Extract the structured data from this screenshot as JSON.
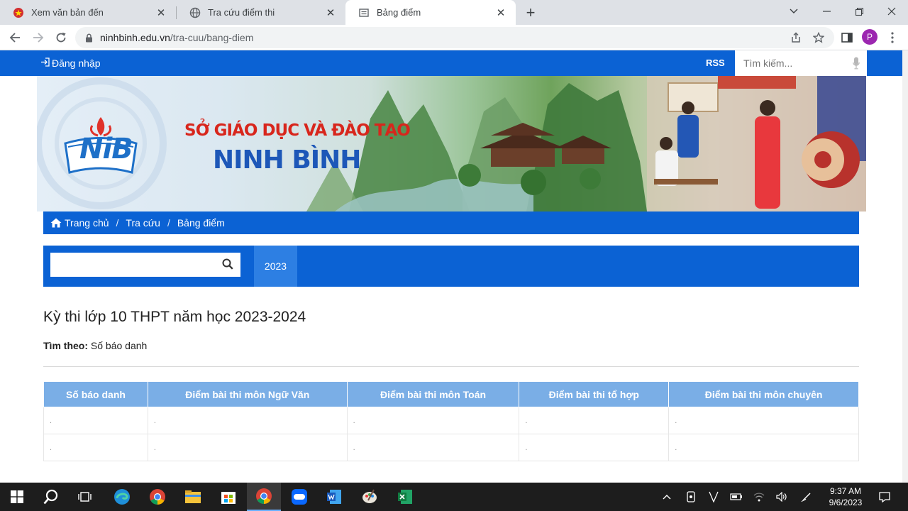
{
  "browser": {
    "tabs": [
      {
        "title": "Xem văn bản đến",
        "icon": "government-emblem-icon"
      },
      {
        "title": "Tra cứu điểm thi",
        "icon": "globe-icon"
      },
      {
        "title": "Bảng điểm",
        "icon": "page-icon"
      }
    ],
    "url_host": "ninhbinh.edu.vn",
    "url_path": "/tra-cuu/bang-diem",
    "profile_initial": "P"
  },
  "site": {
    "login_label": "Đăng nhập",
    "rss_label": "RSS",
    "search_placeholder": "Tìm kiếm...",
    "banner": {
      "logo_text": "NiB",
      "line1": "SỞ GIÁO DỤC VÀ ĐÀO TẠO",
      "line2": "NINH BÌNH"
    },
    "breadcrumb": [
      "Trang chủ",
      "Tra cứu",
      "Bảng điểm"
    ],
    "breadcrumb_sep": "/",
    "filter": {
      "search_value": "",
      "year": "2023"
    },
    "exam_title": "Kỳ thi lớp 10 THPT năm học 2023-2024",
    "search_by_label": "Tìm theo:",
    "search_by_value": "Số báo danh",
    "table": {
      "columns": [
        "Số báo danh",
        "Điểm bài thi môn Ngữ Văn",
        "Điểm bài thi môn Toán",
        "Điểm bài thi tổ hợp",
        "Điểm bài thi môn chuyên"
      ],
      "rows": [
        [
          ".",
          ".",
          ".",
          ".",
          "."
        ],
        [
          ".",
          ".",
          ".",
          ".",
          "."
        ]
      ]
    }
  },
  "taskbar": {
    "time": "9:37 AM",
    "date": "9/6/2023",
    "apps": [
      "windows-start-icon",
      "search-icon",
      "task-view-icon",
      "edge-icon",
      "chrome-icon",
      "file-explorer-icon",
      "store-icon",
      "chrome-icon",
      "zalo-icon",
      "word-icon",
      "paint-icon",
      "excel-icon"
    ]
  },
  "colors": {
    "site_blue": "#0b62d4",
    "table_header": "#7aaee6",
    "year_tab": "#2d7fe3"
  }
}
